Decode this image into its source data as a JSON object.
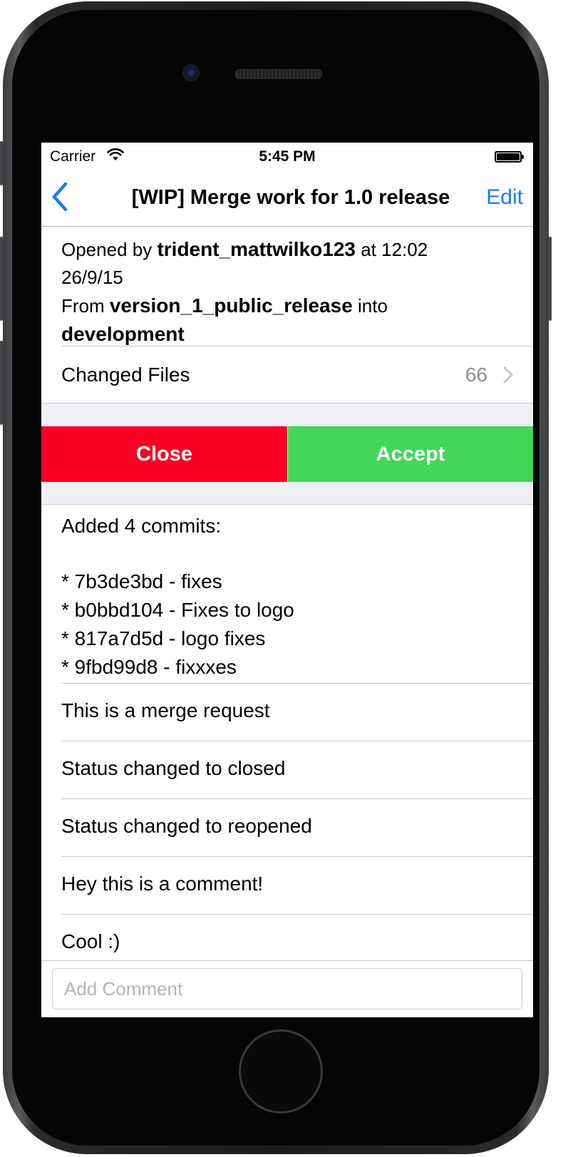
{
  "status_bar": {
    "carrier": "Carrier",
    "time": "5:45 PM"
  },
  "nav": {
    "title": "[WIP] Merge work for 1.0 release",
    "edit_label": "Edit"
  },
  "info": {
    "opened_by_prefix": "Opened by",
    "author": "trident_mattwilko123",
    "at_word": "at",
    "time": "12:02",
    "date": "26/9/15",
    "from_word": "From",
    "source_branch": "version_1_public_release",
    "into_word": "into",
    "target_branch": "development"
  },
  "changed_files": {
    "label": "Changed Files",
    "count": "66"
  },
  "actions": {
    "close_label": "Close",
    "accept_label": "Accept"
  },
  "commits": {
    "header": "Added 4 commits:",
    "items": [
      "* 7b3de3bd - fixes",
      "* b0bbd104 - Fixes to logo",
      "* 817a7d5d - logo fixes",
      "* 9fbd99d8 - fixxxes"
    ]
  },
  "comments": [
    "This is a merge request",
    "Status changed to closed",
    "Status changed to reopened",
    "Hey this is a comment!",
    "Cool :)"
  ],
  "comment_input": {
    "placeholder": "Add Comment",
    "value": ""
  },
  "colors": {
    "accent": "#1a7cf4",
    "close": "#fb0124",
    "accept": "#43d659",
    "group_background": "#efeff4"
  }
}
